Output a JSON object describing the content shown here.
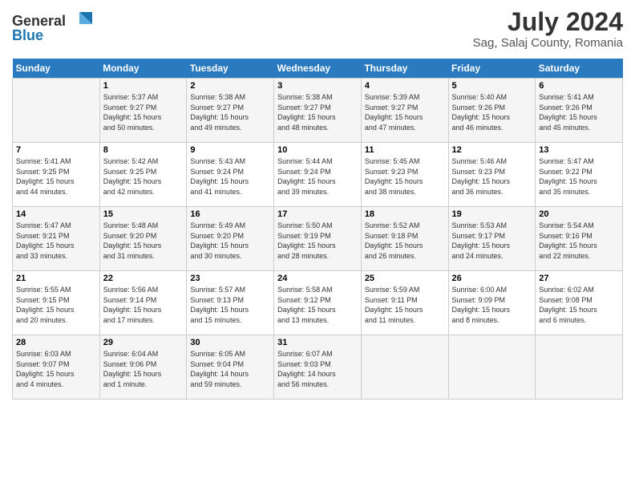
{
  "header": {
    "logo_line1": "General",
    "logo_line2": "Blue",
    "title": "July 2024",
    "subtitle": "Sag, Salaj County, Romania"
  },
  "days_of_week": [
    "Sunday",
    "Monday",
    "Tuesday",
    "Wednesday",
    "Thursday",
    "Friday",
    "Saturday"
  ],
  "weeks": [
    [
      {
        "day": "",
        "info": ""
      },
      {
        "day": "1",
        "info": "Sunrise: 5:37 AM\nSunset: 9:27 PM\nDaylight: 15 hours\nand 50 minutes."
      },
      {
        "day": "2",
        "info": "Sunrise: 5:38 AM\nSunset: 9:27 PM\nDaylight: 15 hours\nand 49 minutes."
      },
      {
        "day": "3",
        "info": "Sunrise: 5:38 AM\nSunset: 9:27 PM\nDaylight: 15 hours\nand 48 minutes."
      },
      {
        "day": "4",
        "info": "Sunrise: 5:39 AM\nSunset: 9:27 PM\nDaylight: 15 hours\nand 47 minutes."
      },
      {
        "day": "5",
        "info": "Sunrise: 5:40 AM\nSunset: 9:26 PM\nDaylight: 15 hours\nand 46 minutes."
      },
      {
        "day": "6",
        "info": "Sunrise: 5:41 AM\nSunset: 9:26 PM\nDaylight: 15 hours\nand 45 minutes."
      }
    ],
    [
      {
        "day": "7",
        "info": "Sunrise: 5:41 AM\nSunset: 9:25 PM\nDaylight: 15 hours\nand 44 minutes."
      },
      {
        "day": "8",
        "info": "Sunrise: 5:42 AM\nSunset: 9:25 PM\nDaylight: 15 hours\nand 42 minutes."
      },
      {
        "day": "9",
        "info": "Sunrise: 5:43 AM\nSunset: 9:24 PM\nDaylight: 15 hours\nand 41 minutes."
      },
      {
        "day": "10",
        "info": "Sunrise: 5:44 AM\nSunset: 9:24 PM\nDaylight: 15 hours\nand 39 minutes."
      },
      {
        "day": "11",
        "info": "Sunrise: 5:45 AM\nSunset: 9:23 PM\nDaylight: 15 hours\nand 38 minutes."
      },
      {
        "day": "12",
        "info": "Sunrise: 5:46 AM\nSunset: 9:23 PM\nDaylight: 15 hours\nand 36 minutes."
      },
      {
        "day": "13",
        "info": "Sunrise: 5:47 AM\nSunset: 9:22 PM\nDaylight: 15 hours\nand 35 minutes."
      }
    ],
    [
      {
        "day": "14",
        "info": "Sunrise: 5:47 AM\nSunset: 9:21 PM\nDaylight: 15 hours\nand 33 minutes."
      },
      {
        "day": "15",
        "info": "Sunrise: 5:48 AM\nSunset: 9:20 PM\nDaylight: 15 hours\nand 31 minutes."
      },
      {
        "day": "16",
        "info": "Sunrise: 5:49 AM\nSunset: 9:20 PM\nDaylight: 15 hours\nand 30 minutes."
      },
      {
        "day": "17",
        "info": "Sunrise: 5:50 AM\nSunset: 9:19 PM\nDaylight: 15 hours\nand 28 minutes."
      },
      {
        "day": "18",
        "info": "Sunrise: 5:52 AM\nSunset: 9:18 PM\nDaylight: 15 hours\nand 26 minutes."
      },
      {
        "day": "19",
        "info": "Sunrise: 5:53 AM\nSunset: 9:17 PM\nDaylight: 15 hours\nand 24 minutes."
      },
      {
        "day": "20",
        "info": "Sunrise: 5:54 AM\nSunset: 9:16 PM\nDaylight: 15 hours\nand 22 minutes."
      }
    ],
    [
      {
        "day": "21",
        "info": "Sunrise: 5:55 AM\nSunset: 9:15 PM\nDaylight: 15 hours\nand 20 minutes."
      },
      {
        "day": "22",
        "info": "Sunrise: 5:56 AM\nSunset: 9:14 PM\nDaylight: 15 hours\nand 17 minutes."
      },
      {
        "day": "23",
        "info": "Sunrise: 5:57 AM\nSunset: 9:13 PM\nDaylight: 15 hours\nand 15 minutes."
      },
      {
        "day": "24",
        "info": "Sunrise: 5:58 AM\nSunset: 9:12 PM\nDaylight: 15 hours\nand 13 minutes."
      },
      {
        "day": "25",
        "info": "Sunrise: 5:59 AM\nSunset: 9:11 PM\nDaylight: 15 hours\nand 11 minutes."
      },
      {
        "day": "26",
        "info": "Sunrise: 6:00 AM\nSunset: 9:09 PM\nDaylight: 15 hours\nand 8 minutes."
      },
      {
        "day": "27",
        "info": "Sunrise: 6:02 AM\nSunset: 9:08 PM\nDaylight: 15 hours\nand 6 minutes."
      }
    ],
    [
      {
        "day": "28",
        "info": "Sunrise: 6:03 AM\nSunset: 9:07 PM\nDaylight: 15 hours\nand 4 minutes."
      },
      {
        "day": "29",
        "info": "Sunrise: 6:04 AM\nSunset: 9:06 PM\nDaylight: 15 hours\nand 1 minute."
      },
      {
        "day": "30",
        "info": "Sunrise: 6:05 AM\nSunset: 9:04 PM\nDaylight: 14 hours\nand 59 minutes."
      },
      {
        "day": "31",
        "info": "Sunrise: 6:07 AM\nSunset: 9:03 PM\nDaylight: 14 hours\nand 56 minutes."
      },
      {
        "day": "",
        "info": ""
      },
      {
        "day": "",
        "info": ""
      },
      {
        "day": "",
        "info": ""
      }
    ]
  ]
}
